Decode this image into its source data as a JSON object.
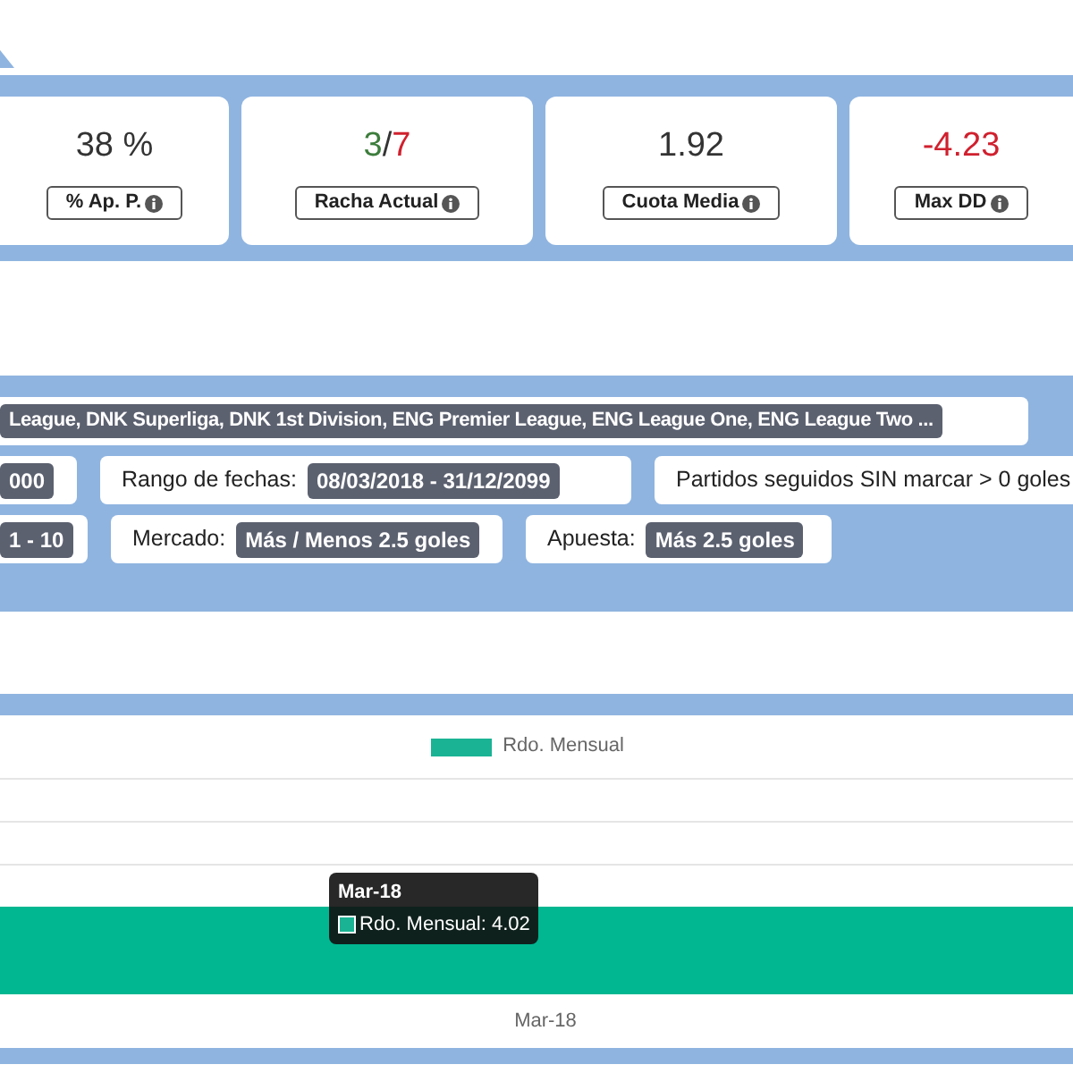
{
  "stats": [
    {
      "label": "% Ap. P.",
      "parts": [
        {
          "text": "38 %",
          "color": "#333333"
        }
      ]
    },
    {
      "label": "Racha Actual",
      "parts": [
        {
          "text": "3",
          "color": "#3c7d3c"
        },
        {
          "text": "/",
          "color": "#333333"
        },
        {
          "text": "7",
          "color": "#d0202e"
        }
      ]
    },
    {
      "label": "Cuota Media",
      "parts": [
        {
          "text": "1.92",
          "color": "#333333"
        }
      ]
    },
    {
      "label": "Max DD",
      "parts": [
        {
          "text": "-4.23",
          "color": "#d0202e"
        }
      ]
    }
  ],
  "filters": [
    [
      {
        "value": "League, DNK Superliga, DNK 1st Division, ENG Premier League, ENG League One, ENG League Two ..."
      }
    ],
    [
      {
        "value": "000"
      },
      {
        "label": "Rango de fechas:",
        "value": "08/03/2018 - 31/12/2099"
      },
      {
        "label": "Partidos seguidos SIN marcar > 0 goles"
      }
    ],
    [
      {
        "value": "1 - 10"
      },
      {
        "label": "Mercado:",
        "value": "Más / Menos 2.5 goles"
      },
      {
        "label": "Apuesta:",
        "value": "Más 2.5 goles"
      }
    ]
  ],
  "chart": {
    "legend": "Rdo. Mensual",
    "tooltip": {
      "title": "Mar-18",
      "text": "Rdo. Mensual: 4.02"
    },
    "x_label": "Mar-18"
  }
}
